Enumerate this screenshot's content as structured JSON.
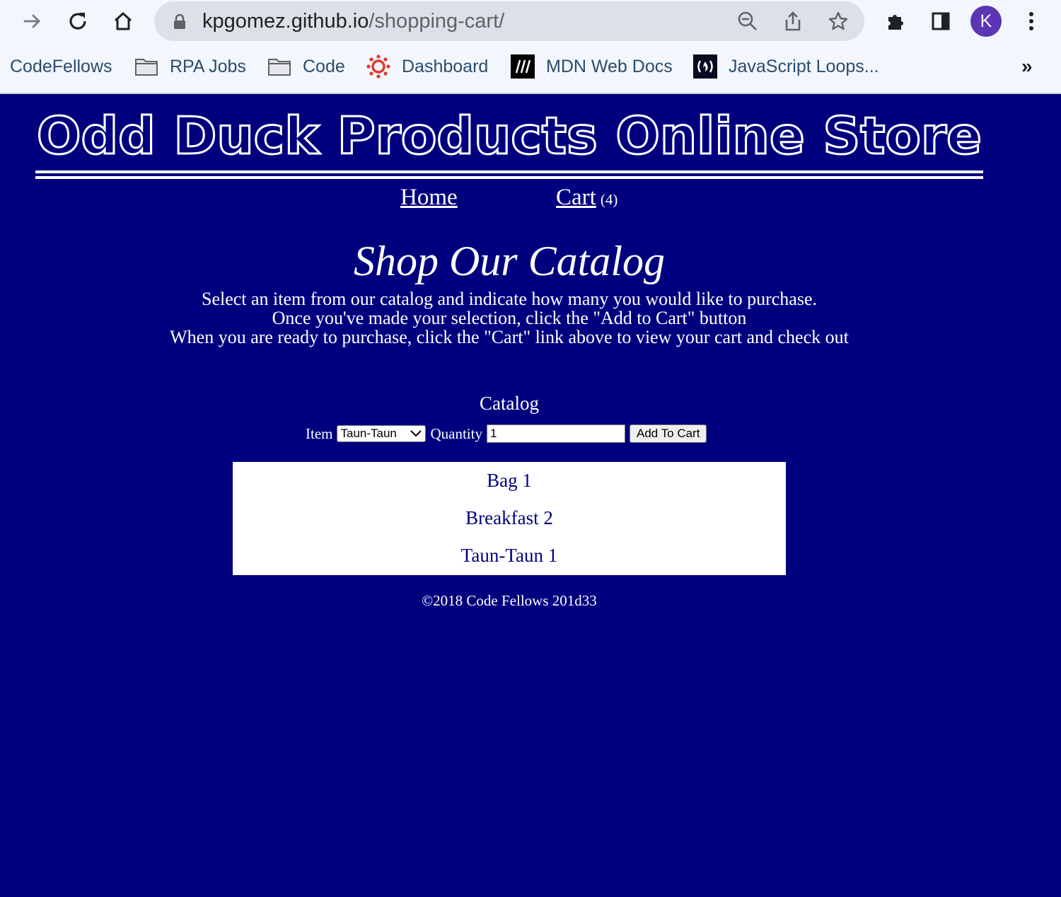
{
  "browser": {
    "url_host": "kpgomez.github.io",
    "url_path": "/shopping-cart/",
    "profile_initial": "K",
    "bookmarks": [
      {
        "label": "CodeFellows",
        "icon": "none"
      },
      {
        "label": "RPA Jobs",
        "icon": "folder-icon"
      },
      {
        "label": "Code",
        "icon": "folder-icon"
      },
      {
        "label": "Dashboard",
        "icon": "canvas-icon"
      },
      {
        "label": "MDN Web Docs",
        "icon": "mdn-icon"
      },
      {
        "label": "JavaScript Loops...",
        "icon": "freecodecamp-icon"
      }
    ],
    "more_label": "»"
  },
  "site": {
    "logo_text": "Odd Duck Products Online Store",
    "nav": {
      "home": "Home",
      "cart": "Cart",
      "cart_count": "(4)"
    },
    "heading": "Shop Our Catalog",
    "intro": [
      "Select an item from our catalog and indicate how many you would like to purchase.",
      "Once you've made your selection, click the \"Add to Cart\" button",
      "When you are ready to purchase, click the \"Cart\" link above to view your cart and check out"
    ],
    "catalog_title": "Catalog",
    "form": {
      "item_label": "Item",
      "item_selected": "Taun-Taun",
      "quantity_label": "Quantity",
      "quantity_value": "1",
      "add_button": "Add To Cart"
    },
    "cart_items": [
      "Bag 1",
      "Breakfast 2",
      "Taun-Taun 1"
    ],
    "footer": "©2018 Code Fellows 201d33"
  },
  "colors": {
    "page_bg": "#00007f",
    "text": "#ffffff",
    "cart_text": "#00007f"
  }
}
